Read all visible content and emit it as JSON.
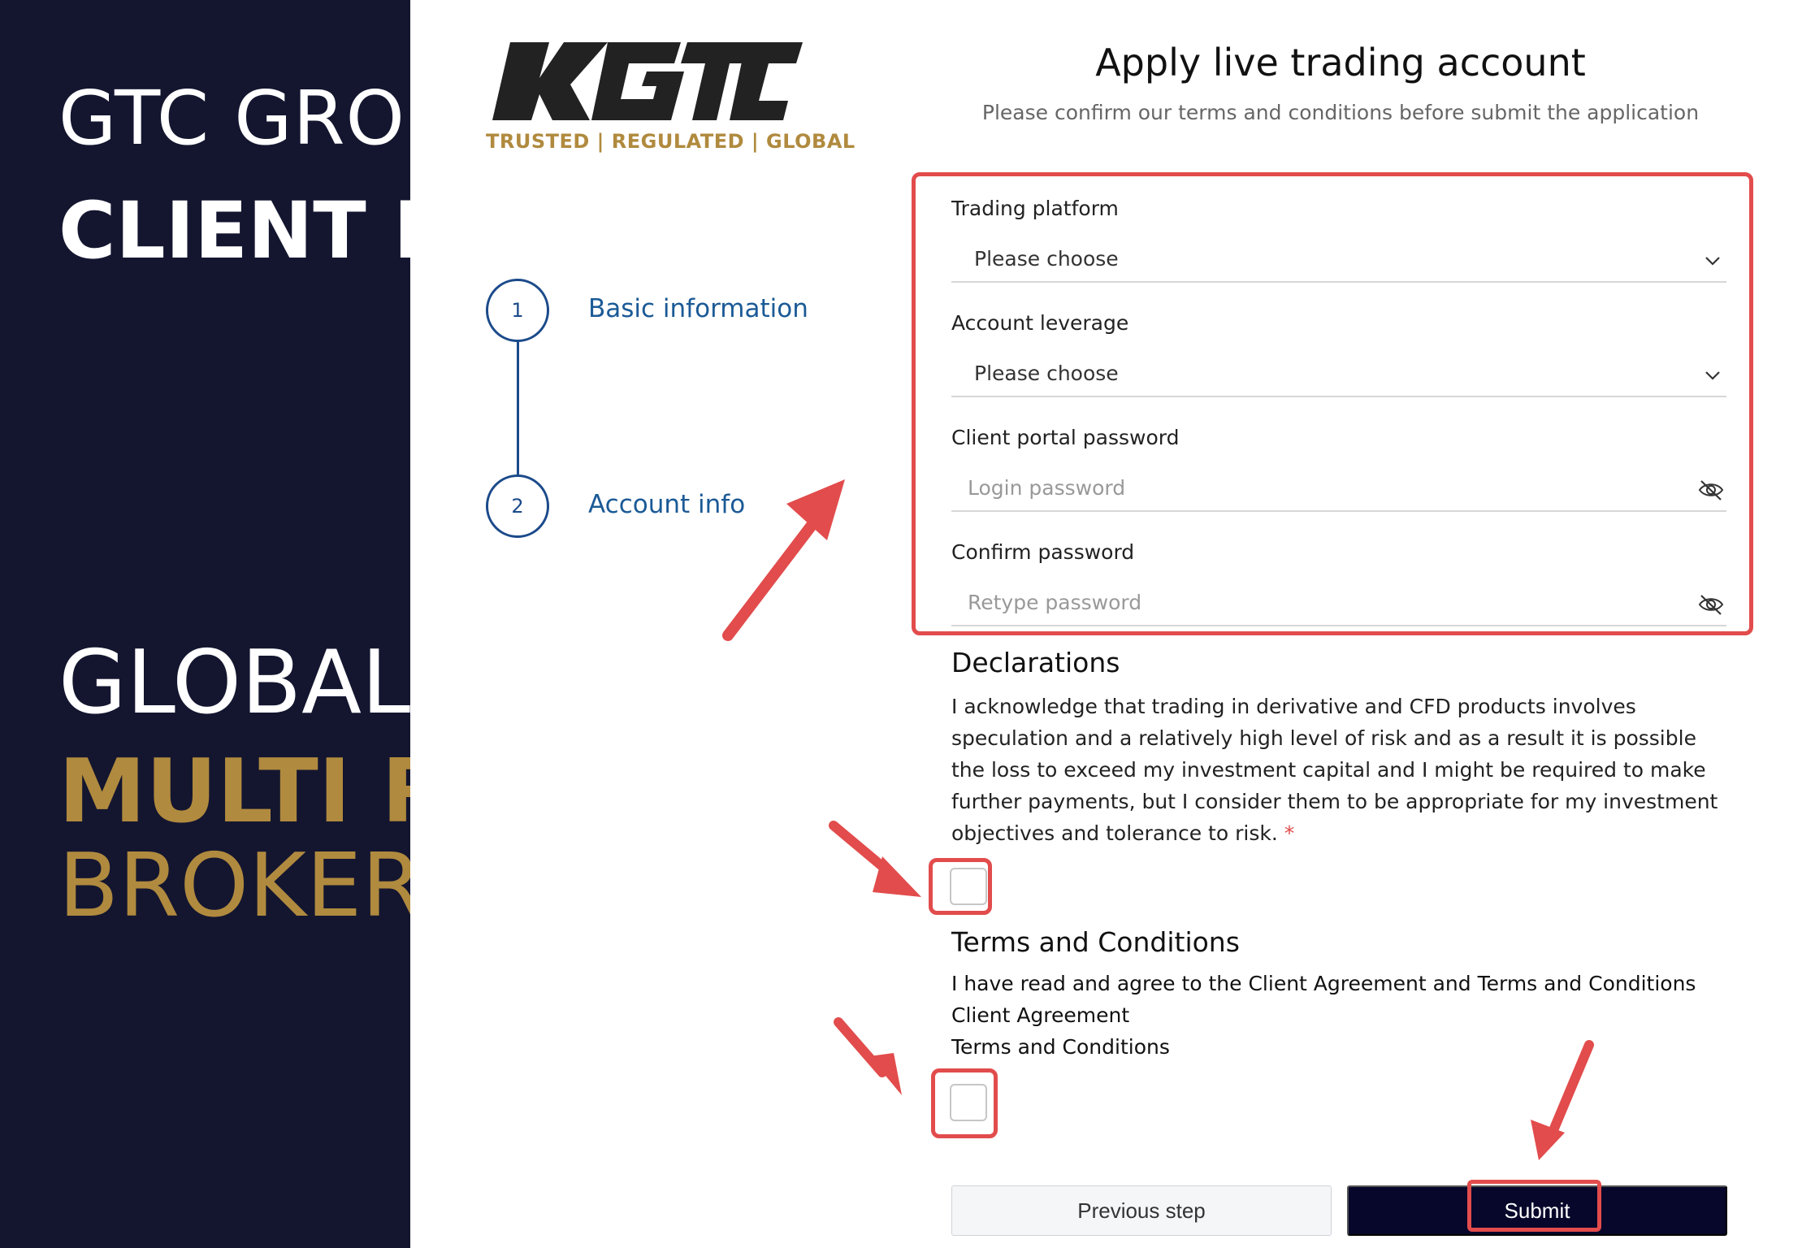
{
  "banner": {
    "line1": "GTC GROUP",
    "line2": "CLIENT PORTAL",
    "line3": "GLOBALLY",
    "line4": "MULTI REGULATED",
    "line5": "BROKER"
  },
  "logo": {
    "wordmark": "GTC",
    "tagline": "TRUSTED | REGULATED | GLOBAL"
  },
  "stepper": {
    "steps": [
      {
        "number": "1",
        "label": "Basic information"
      },
      {
        "number": "2",
        "label": "Account info"
      }
    ]
  },
  "header": {
    "title": "Apply live trading account",
    "subtitle": "Please confirm our terms and conditions before submit the application"
  },
  "form": {
    "trading_platform": {
      "label": "Trading platform",
      "value": "Please choose"
    },
    "account_leverage": {
      "label": "Account leverage",
      "value": "Please choose"
    },
    "client_password": {
      "label": "Client portal password",
      "placeholder": "Login password"
    },
    "confirm_password": {
      "label": "Confirm password",
      "placeholder": "Retype password"
    }
  },
  "declarations": {
    "title": "Declarations",
    "text": "I acknowledge that trading in derivative and CFD products involves speculation and a relatively high level of risk and as a result it is possible the loss to exceed my investment capital and I might be required to make further payments, but I consider them to be appropriate for my investment objectives and tolerance to risk.",
    "required_mark": "*"
  },
  "terms": {
    "title": "Terms and Conditions",
    "text": "I have read and agree to the Client Agreement and Terms and Conditions",
    "link_client_agreement": "Client Agreement",
    "link_terms": "Terms and Conditions"
  },
  "buttons": {
    "previous": "Previous step",
    "submit": "Submit"
  },
  "colors": {
    "banner_bg": "#141630",
    "gold": "#b08a3e",
    "step_blue": "#1b4a8a",
    "submit_bg": "#07072b",
    "annotation_red": "#e24c4c"
  }
}
